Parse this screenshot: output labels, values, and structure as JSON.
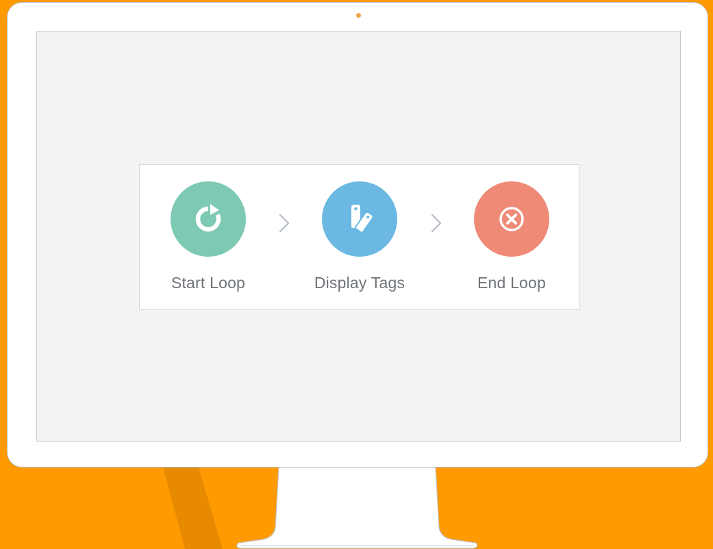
{
  "colors": {
    "background": "#ff9a00",
    "background_shadow": "#e88a00",
    "start_loop": "#7dc9b4",
    "display_tags": "#6bb8e2",
    "end_loop": "#ef8a77",
    "label_text": "#6e7378",
    "arrow": "#b5bcc3"
  },
  "flow": {
    "steps": [
      {
        "label": "Start Loop",
        "icon": "refresh-icon"
      },
      {
        "label": "Display Tags",
        "icon": "tags-icon"
      },
      {
        "label": "End Loop",
        "icon": "close-circle-icon"
      }
    ],
    "separators": [
      "chevron-right-icon",
      "chevron-right-icon"
    ]
  }
}
